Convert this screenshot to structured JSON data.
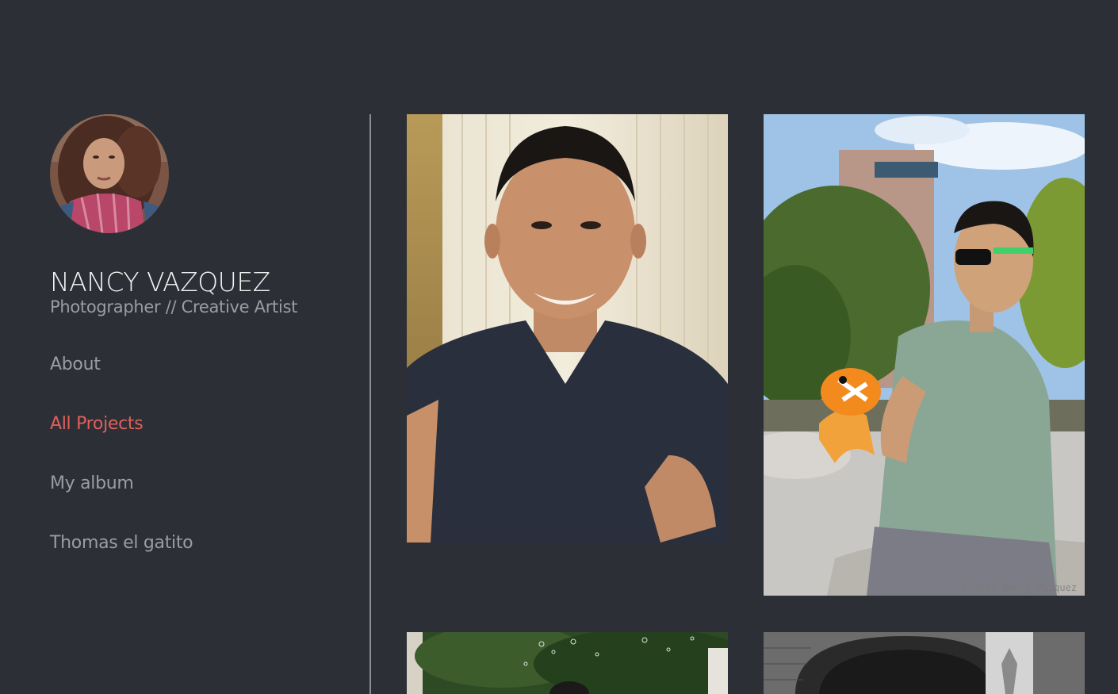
{
  "profile": {
    "name": "NANCY VAZQUEZ",
    "tagline": "Photographer // Creative Artist",
    "avatar_icon": "portrait-photo"
  },
  "nav": {
    "items": [
      {
        "label": "About",
        "active": false
      },
      {
        "label": "All Projects",
        "active": true
      },
      {
        "label": "My album",
        "active": false
      },
      {
        "label": "Thomas el gatito",
        "active": false
      }
    ]
  },
  "gallery": {
    "photos": [
      {
        "name": "selfie-portrait"
      },
      {
        "name": "man-with-toy-gun-in-park",
        "watermark": "© 2017 Nancy Vazquez"
      },
      {
        "name": "park-with-bubbles"
      },
      {
        "name": "black-and-white-arch"
      }
    ]
  },
  "colors": {
    "background": "#2c2f36",
    "accent": "#e0605a",
    "text_muted": "#9a9da3",
    "text_primary": "#f3f3f3"
  }
}
